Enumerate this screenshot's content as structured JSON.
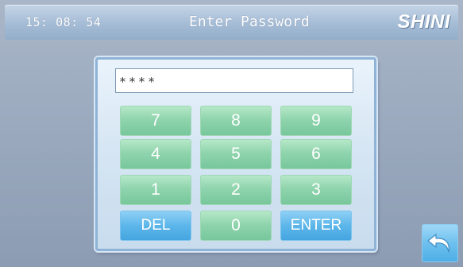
{
  "header": {
    "time": "15: 08: 54",
    "title": "Enter Password",
    "logo": "SHINI"
  },
  "password": {
    "masked_value": "****"
  },
  "keypad": {
    "k7": "7",
    "k8": "8",
    "k9": "9",
    "k4": "4",
    "k5": "5",
    "k6": "6",
    "k1": "1",
    "k2": "2",
    "k3": "3",
    "del": "DEL",
    "k0": "0",
    "enter": "ENTER"
  },
  "icons": {
    "back": "return-arrow-icon"
  },
  "colors": {
    "digit_key": "#8fd4ad",
    "action_key": "#5cb6ea",
    "header": "#a5bcd6",
    "background": "#97a6bb"
  }
}
